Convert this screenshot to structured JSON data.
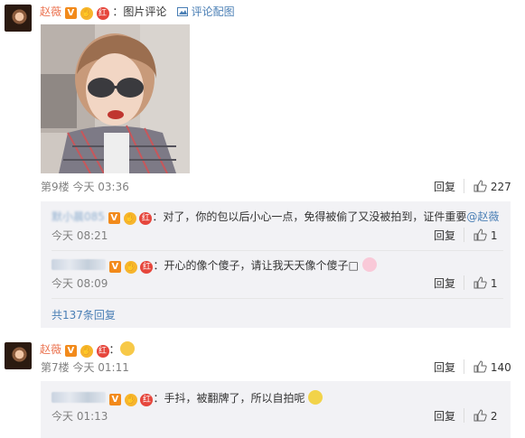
{
  "comments": [
    {
      "author": "赵薇",
      "prefix": "：",
      "text": "图片评论",
      "attach_label": "评论配图",
      "floor": "第9楼",
      "time": "今天 03:36",
      "reply_label": "回复",
      "likes": "227",
      "replies": [
        {
          "author": "默小晨085",
          "text": "：对了，你的包以后小心一点，免得被偷了又没被拍到，证件重要",
          "mention": "@赵薇",
          "time": "今天 08:21",
          "reply_label": "回复",
          "likes": "1"
        },
        {
          "author": "",
          "text": "：开心的像个傻子，请让我天天像个傻子□",
          "time": "今天 08:09",
          "reply_label": "回复",
          "likes": "1"
        }
      ],
      "more_replies": "共137条回复"
    },
    {
      "author": "赵薇",
      "prefix": "：",
      "floor": "第7楼",
      "time": "今天 01:11",
      "reply_label": "回复",
      "likes": "140",
      "replies": [
        {
          "author": "",
          "text": "：手抖，被翻牌了，所以自拍呢",
          "time": "今天 01:13",
          "reply_label": "回复",
          "likes": "2"
        }
      ]
    }
  ],
  "colors": {
    "name_orange": "#eb7350",
    "link_blue": "#4a7fb5",
    "reply_bg": "#f2f2f5",
    "meta_gray": "#808080"
  },
  "icons": [
    "verified-v-icon",
    "hand-badge-icon",
    "red-badge-icon",
    "picture-icon",
    "thumbs-up-icon",
    "emoji-icon"
  ]
}
